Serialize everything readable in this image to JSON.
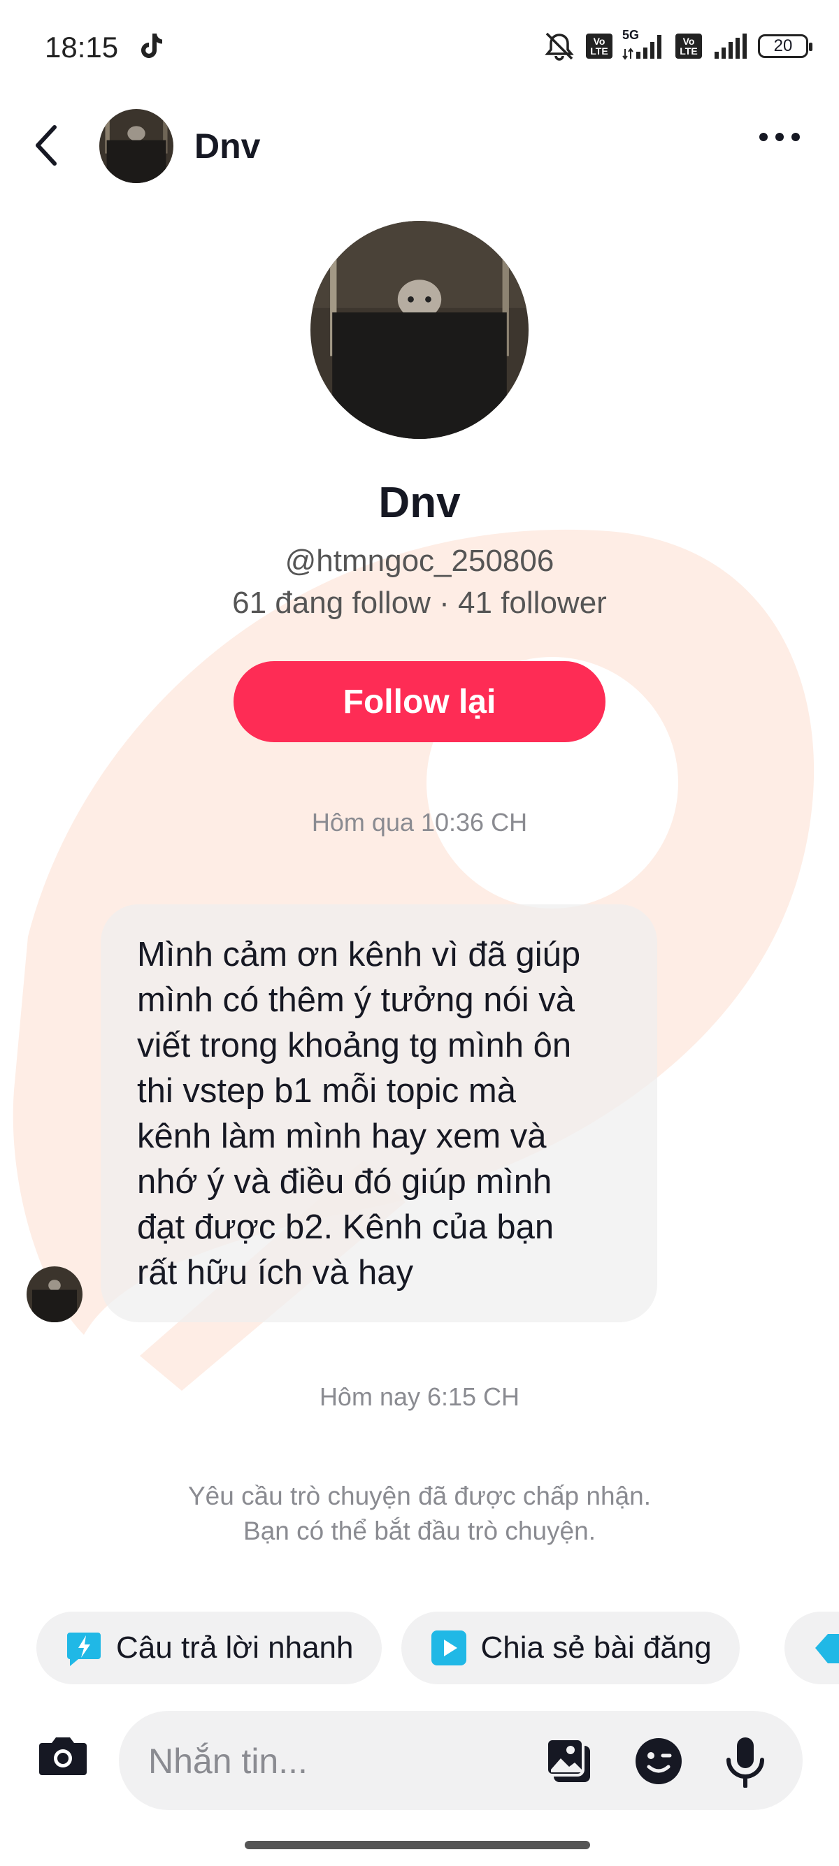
{
  "status_bar": {
    "time": "18:15",
    "network": "5G",
    "volte": "Vo LTE",
    "battery": "20"
  },
  "header": {
    "name": "Dnv"
  },
  "profile": {
    "name": "Dnv",
    "handle": "@htmngoc_250806",
    "stats": "61 đang follow · 41 follower",
    "follow_button": "Follow lại"
  },
  "messages": {
    "timestamp_1": "Hôm qua 10:36 CH",
    "bubble_lines": [
      "Mình cảm ơn kênh vì đã giúp",
      "mình có thêm ý tưởng nói và",
      "viết trong khoảng tg mình ôn",
      "thi vstep b1 mỗi topic mà",
      "kênh làm mình hay xem và",
      "nhớ ý và điều đó giúp mình",
      "đạt được b2. Kênh của bạn",
      "rất hữu ích và hay"
    ],
    "timestamp_2": "Hôm nay 6:15 CH",
    "notice_line1": "Yêu cầu trò chuyện đã được chấp nhận.",
    "notice_line2": "Bạn có thể bắt đầu trò chuyện."
  },
  "chips": {
    "quick_reply": "Câu trả lời nhanh",
    "share_post": "Chia sẻ bài đăng"
  },
  "composer": {
    "placeholder": "Nhắn tin..."
  },
  "colors": {
    "accent": "#fe2c55",
    "chip_icon": "#20b8e6",
    "watermark": "#fde7dc"
  }
}
